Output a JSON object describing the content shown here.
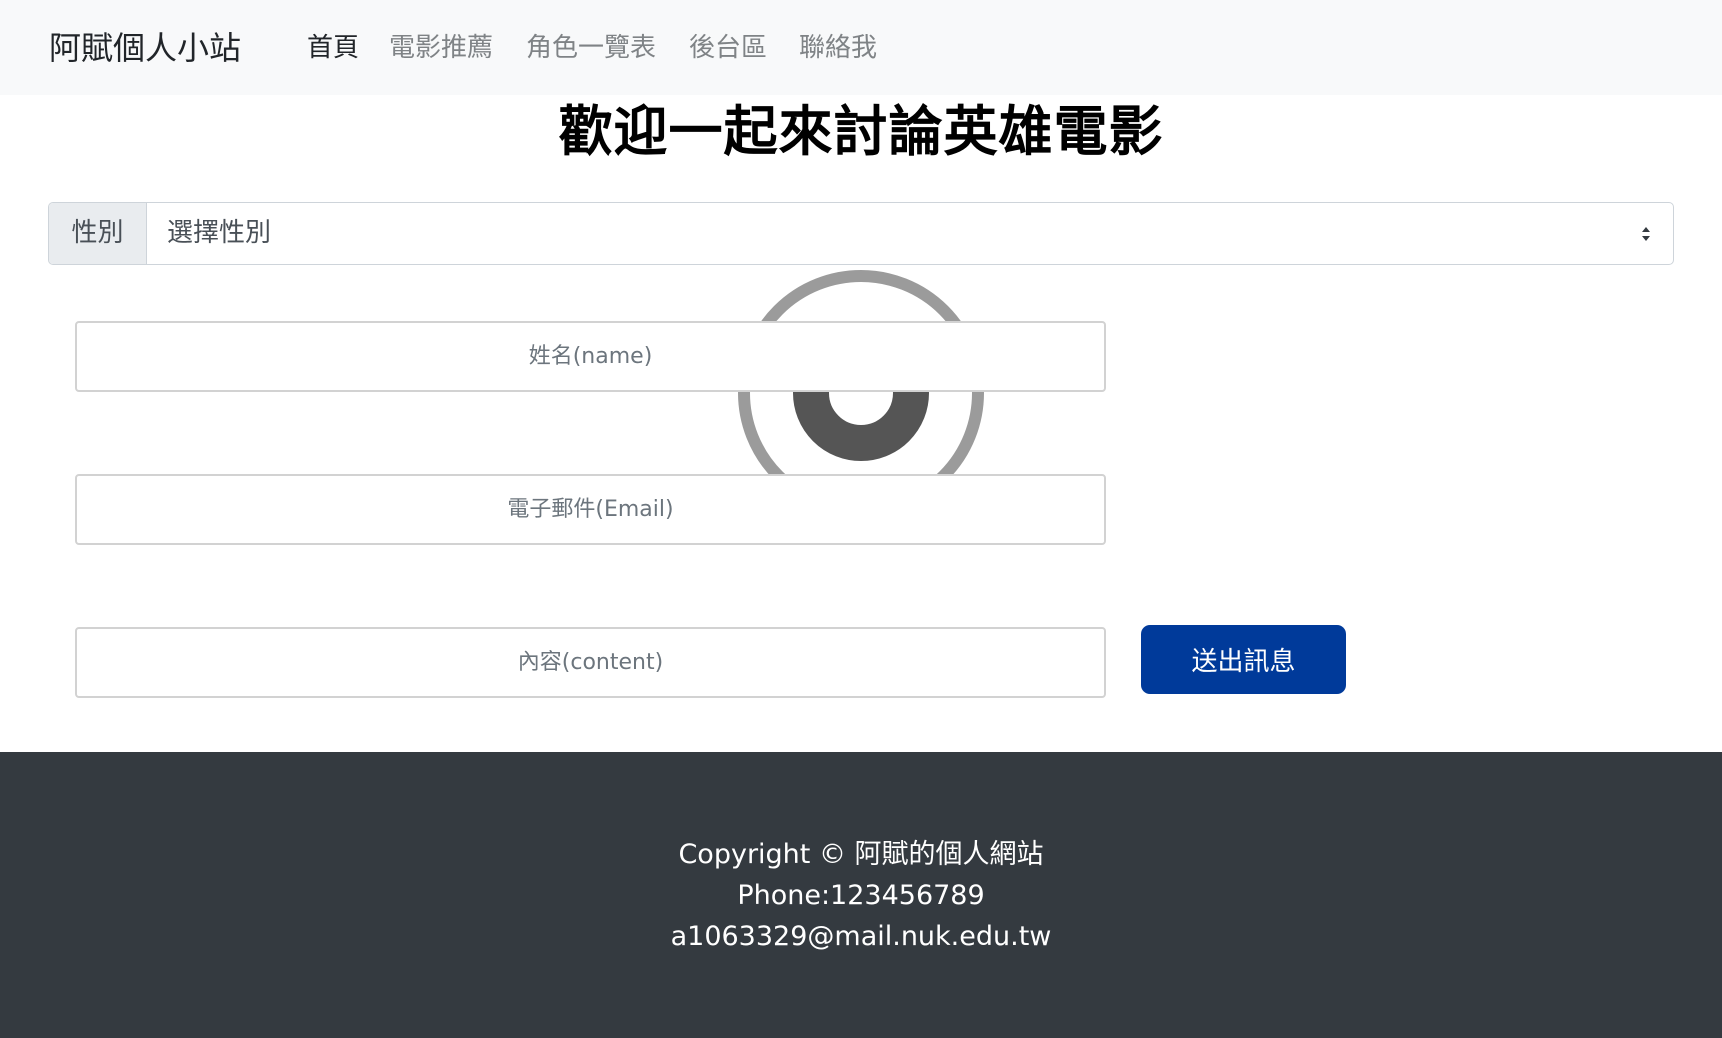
{
  "navbar": {
    "brand": "阿賦個人小站",
    "links": [
      {
        "label": "首頁",
        "active": true
      },
      {
        "label": "電影推薦",
        "active": false
      },
      {
        "label": "角色一覽表",
        "active": false
      },
      {
        "label": "後台區",
        "active": false
      },
      {
        "label": "聯絡我",
        "active": false
      }
    ]
  },
  "main": {
    "title": "歡迎一起來討論英雄電影",
    "gender": {
      "label": "性別",
      "selected": "選擇性別"
    },
    "form": {
      "name_placeholder": "姓名(name)",
      "email_placeholder": "電子郵件(Email)",
      "content_placeholder": "內容(content)",
      "submit_label": "送出訊息"
    }
  },
  "footer": {
    "copyright": "Copyright © 阿賦的個人網站",
    "phone": "Phone:123456789",
    "email": "a1063329@mail.nuk.edu.tw"
  },
  "colors": {
    "navbar_bg": "#f8f9fa",
    "submit_bg": "#003a9a",
    "footer_bg": "#343a40"
  }
}
